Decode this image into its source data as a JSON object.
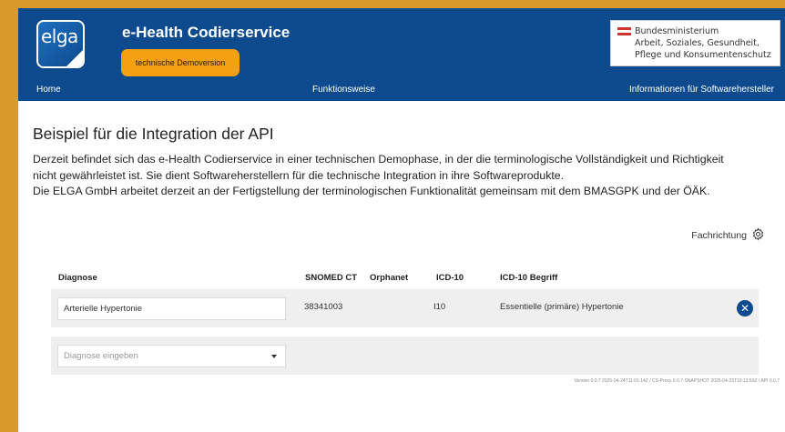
{
  "header": {
    "logo_text": "elga",
    "title": "e-Health Codierservice",
    "badge": "technische Demoversion",
    "ministry_lines": [
      "Bundesministerium",
      "Arbeit, Soziales, Gesundheit,",
      "Pflege und Konsumentenschutz"
    ]
  },
  "nav": {
    "home": "Home",
    "funktionsweise": "Funktionsweise",
    "info": "Informationen für Softwarehersteller"
  },
  "main": {
    "title": "Beispiel für die Integration der API",
    "intro": [
      "Derzeit befindet sich das e-Health Codierservice in einer technischen Demophase, in der die terminologische Vollständigkeit und Richtigkeit",
      "nicht gewährleistet ist. Sie dient Softwareherstellern für die technische Integration in ihre Softwareprodukte.",
      "Die ELGA GmbH arbeitet derzeit an der Fertigstellung der terminologischen Funktionalität gemeinsam mit dem BMASGPK und der ÖÄK."
    ],
    "fachrichtung": "Fachrichtung"
  },
  "table": {
    "headers": [
      "Diagnose",
      "SNOMED CT",
      "Orphanet",
      "ICD-10",
      "ICD-10 Begriff"
    ],
    "rows": [
      {
        "diagnose": "Arterielle Hypertonie",
        "snomed": "38341003",
        "orphanet": "",
        "icd10": "I10",
        "icd10_begriff": "Essentielle (primäre) Hypertonie"
      }
    ],
    "new_placeholder": "Diagnose eingeben"
  },
  "footer": {
    "version": "Version 0.0.7 2025-04-24T11:01:14Z / CS-Proxy 0.0.7-SNAPSHOT 2025-04-23T10:13:50Z / API 0.0.7"
  },
  "colors": {
    "primary": "#0d4b8e",
    "accent": "#f5a012",
    "frame": "#d99a2b"
  }
}
